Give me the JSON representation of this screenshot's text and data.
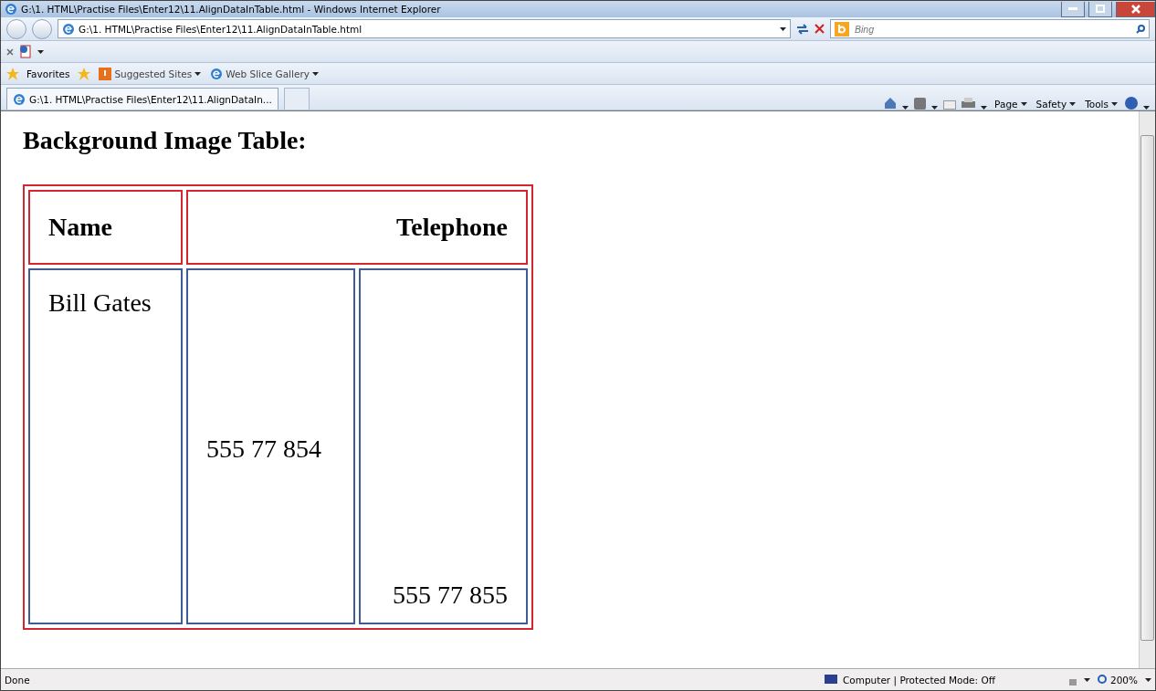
{
  "window": {
    "title": "G:\\1. HTML\\Practise Files\\Enter12\\11.AlignDataInTable.html - Windows Internet Explorer"
  },
  "address_bar": {
    "value": "G:\\1. HTML\\Practise Files\\Enter12\\11.AlignDataInTable.html"
  },
  "search": {
    "placeholder": "Bing"
  },
  "favorites_bar": {
    "label": "Favorites",
    "links": [
      "Suggested Sites",
      "Web Slice Gallery"
    ]
  },
  "tabs": [
    {
      "label": "G:\\1. HTML\\Practise Files\\Enter12\\11.AlignDataIn...",
      "selected": true
    }
  ],
  "command_bar": [
    "Page",
    "Safety",
    "Tools"
  ],
  "page": {
    "heading": "Background Image Table:",
    "table": {
      "header": [
        "Name",
        "Telephone"
      ],
      "row": [
        "Bill Gates",
        "555 77 854",
        "555 77 855"
      ]
    }
  },
  "status_bar": {
    "status": "Done",
    "zone": "Computer | Protected Mode: Off",
    "zoom": "200%"
  }
}
